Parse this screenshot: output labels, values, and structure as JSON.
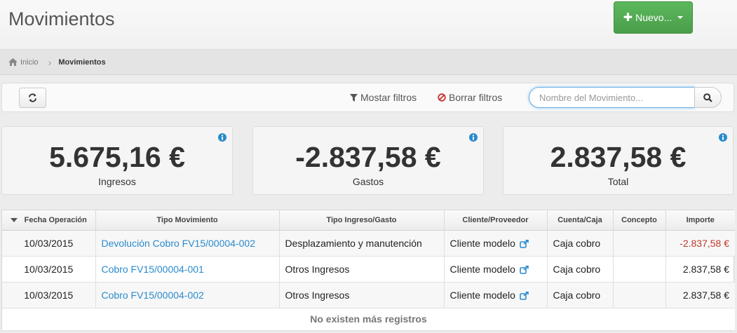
{
  "header": {
    "title": "Movimientos",
    "new_button_label": "Nuevo..."
  },
  "breadcrumb": {
    "home": "Inicio",
    "current": "Movimientos"
  },
  "toolbar": {
    "show_filters": "Mostar filtros",
    "clear_filters": "Borrar filtros",
    "search_placeholder": "Nombre del Movimiento..."
  },
  "stats": [
    {
      "value": "5.675,16 €",
      "label": "Ingresos"
    },
    {
      "value": "-2.837,58 €",
      "label": "Gastos"
    },
    {
      "value": "2.837,58 €",
      "label": "Total"
    }
  ],
  "table": {
    "columns": [
      "Fecha Operación",
      "Tipo Movimiento",
      "Tipo Ingreso/Gasto",
      "Cliente/Proveedor",
      "Cuenta/Caja",
      "Concepto",
      "Importe"
    ],
    "rows": [
      {
        "fecha": "10/03/2015",
        "tipo": "Devolución Cobro FV15/00004-002",
        "tipo_ig": "Desplazamiento y manutención",
        "cliente": "Cliente modelo",
        "cuenta": "Caja cobro",
        "concepto": "",
        "importe": "-2.837,58 €"
      },
      {
        "fecha": "10/03/2015",
        "tipo": "Cobro FV15/00004-001",
        "tipo_ig": "Otros Ingresos",
        "cliente": "Cliente modelo",
        "cuenta": "Caja cobro",
        "concepto": "",
        "importe": "2.837,58 €"
      },
      {
        "fecha": "10/03/2015",
        "tipo": "Cobro FV15/00004-002",
        "tipo_ig": "Otros Ingresos",
        "cliente": "Cliente modelo",
        "cuenta": "Caja cobro",
        "concepto": "",
        "importe": "2.837,58 €"
      }
    ],
    "footer": "No existen más registros"
  },
  "colors": {
    "accent_green": "#5cb85c",
    "link_blue": "#2a8bcc",
    "negative_red": "#c0392b",
    "info_blue": "#2a8bcc"
  }
}
